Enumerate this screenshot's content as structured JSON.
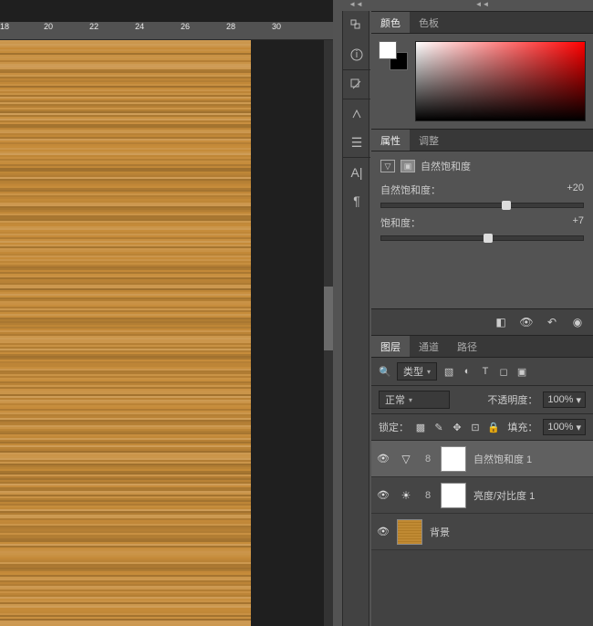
{
  "ruler": {
    "ticks": [
      "18",
      "20",
      "22",
      "24",
      "26",
      "28",
      "30"
    ]
  },
  "colorPanel": {
    "tab1": "颜色",
    "tab2": "色板"
  },
  "propsPanel": {
    "tab1": "属性",
    "tab2": "调整",
    "title": "自然饱和度",
    "slider1": {
      "label": "自然饱和度：",
      "value": "+20",
      "handlePct": 62
    },
    "slider2": {
      "label": "饱和度：",
      "value": "+7",
      "handlePct": 53
    }
  },
  "layersPanel": {
    "tab1": "图层",
    "tab2": "通道",
    "tab3": "路径",
    "filterLabel": "类型",
    "blendMode": "正常",
    "opacityLabel": "不透明度：",
    "opacityVal": "100%",
    "lockLabel": "锁定：",
    "fillLabel": "填充：",
    "fillVal": "100%",
    "layers": [
      {
        "name": "自然饱和度 1",
        "adjIcon": "▽",
        "selected": true
      },
      {
        "name": "亮度/对比度 1",
        "adjIcon": "☀",
        "selected": false
      },
      {
        "name": "背景",
        "wood": true,
        "selected": false
      }
    ]
  },
  "icons": {
    "search": "🔍"
  }
}
